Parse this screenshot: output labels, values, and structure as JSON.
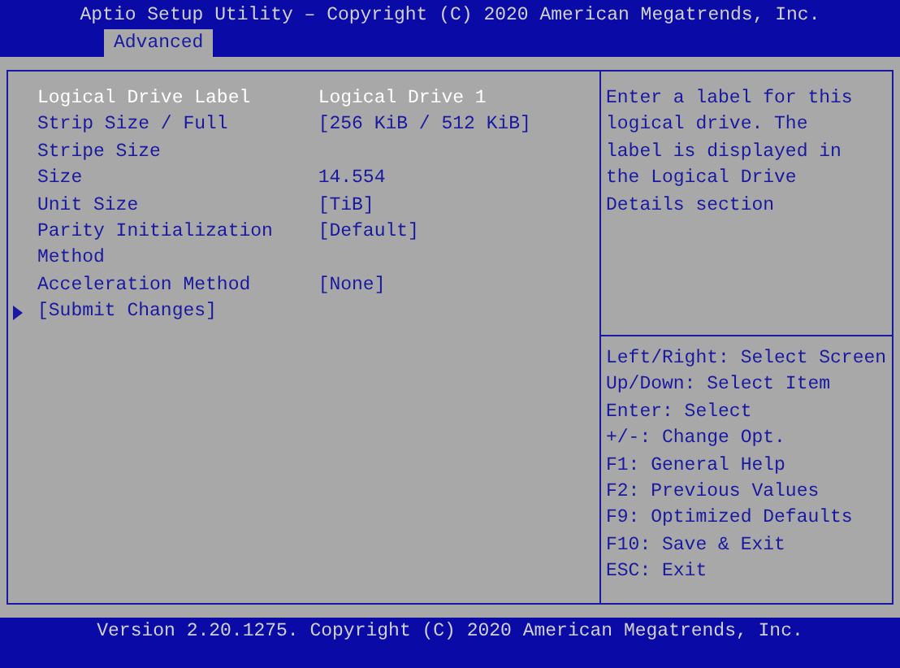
{
  "header": {
    "title": "Aptio Setup Utility – Copyright (C) 2020 American Megatrends, Inc.",
    "tabs": [
      {
        "label": "Advanced",
        "selected": true
      }
    ]
  },
  "items": [
    {
      "kind": "setting",
      "label": "Logical Drive Label",
      "value": "Logical Drive 1",
      "selected": true
    },
    {
      "kind": "setting",
      "label": "Strip Size / Full Stripe Size",
      "value": "[256 KiB / 512 KiB]",
      "selected": false
    },
    {
      "kind": "setting",
      "label": "Size",
      "value": "14.554",
      "selected": false
    },
    {
      "kind": "setting",
      "label": "Unit Size",
      "value": "[TiB]",
      "selected": false
    },
    {
      "kind": "setting",
      "label": "Parity Initialization Method",
      "value": "[Default]",
      "selected": false
    },
    {
      "kind": "setting",
      "label": "Acceleration Method",
      "value": "[None]",
      "selected": false
    },
    {
      "kind": "action",
      "label": "[Submit Changes]",
      "selected": false
    }
  ],
  "help": "Enter a label for this logical drive. The label is displayed in the Logical Drive Details section",
  "keys": [
    "Left/Right: Select Screen",
    "Up/Down: Select Item",
    "Enter: Select",
    "+/-: Change Opt.",
    "F1: General Help",
    "F2: Previous Values",
    "F9: Optimized Defaults",
    "F10: Save & Exit",
    "ESC: Exit"
  ],
  "footer": "Version 2.20.1275. Copyright (C) 2020 American Megatrends, Inc."
}
